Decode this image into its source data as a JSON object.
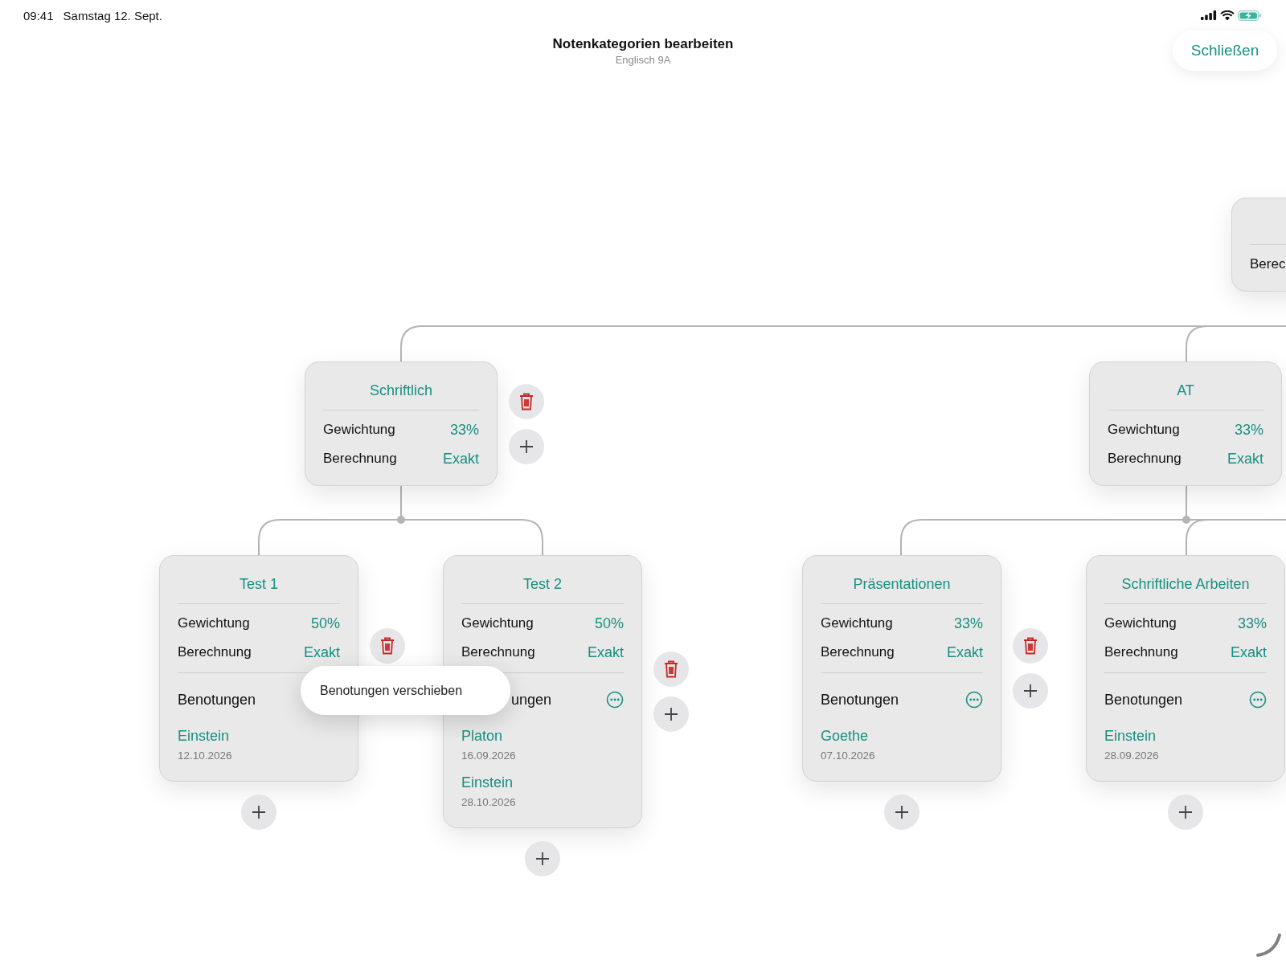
{
  "status_bar": {
    "time": "09:41",
    "date": "Samstag 12. Sept."
  },
  "header": {
    "title": "Notenkategorien bearbeiten",
    "subtitle": "Englisch 9A",
    "close_button": "Schließen"
  },
  "nodes": [
    {
      "kind": "clipped",
      "rows": [
        {
          "label": "Berec"
        }
      ]
    },
    {
      "kind": "category",
      "title": "Schriftlich",
      "rows": [
        {
          "label": "Gewichtung",
          "value": "33%"
        },
        {
          "label": "Berechnung",
          "value": "Exakt"
        }
      ],
      "delete_button": true,
      "add_button": true
    },
    {
      "kind": "category",
      "title": "AT",
      "rows": [
        {
          "label": "Gewichtung",
          "value": "33%"
        },
        {
          "label": "Berechnung",
          "value": "Exakt"
        }
      ]
    },
    {
      "kind": "leaf",
      "title": "Test 1",
      "rows": [
        {
          "label": "Gewichtung",
          "value": "50%"
        },
        {
          "label": "Berechnung",
          "value": "Exakt"
        }
      ],
      "grades_label": "Benotungen",
      "grades_label_covered": false,
      "grades": [
        {
          "name": "Einstein",
          "date": "12.10.2026"
        }
      ],
      "delete_button": true,
      "add_below": true
    },
    {
      "kind": "leaf",
      "title": "Test 2",
      "rows": [
        {
          "label": "Gewichtung",
          "value": "50%"
        },
        {
          "label": "Berechnung",
          "value": "Exakt"
        }
      ],
      "grades_label": "ungen",
      "grades_label_covered": true,
      "grades_menu": true,
      "grades": [
        {
          "name": "Platon",
          "date": "16.09.2026"
        },
        {
          "name": "Einstein",
          "date": "28.10.2026"
        }
      ],
      "delete_button": true,
      "add_button": true,
      "add_below": true
    },
    {
      "kind": "leaf",
      "title": "Präsentationen",
      "rows": [
        {
          "label": "Gewichtung",
          "value": "33%"
        },
        {
          "label": "Berechnung",
          "value": "Exakt"
        }
      ],
      "grades_label": "Benotungen",
      "grades_label_covered": false,
      "grades_menu": true,
      "grades": [
        {
          "name": "Goethe",
          "date": "07.10.2026"
        }
      ],
      "delete_button": true,
      "add_button": true,
      "add_below": true
    },
    {
      "kind": "leaf",
      "title": "Schriftliche Arbeiten",
      "rows": [
        {
          "label": "Gewichtung",
          "value": "33%"
        },
        {
          "label": "Berechnung",
          "value": "Exakt"
        }
      ],
      "grades_label": "Benotungen",
      "grades_label_covered": false,
      "grades_menu": true,
      "grades": [
        {
          "name": "Einstein",
          "date": "28.09.2026"
        }
      ],
      "add_below": true
    }
  ],
  "popup": {
    "label": "Benotungen verschieben"
  }
}
